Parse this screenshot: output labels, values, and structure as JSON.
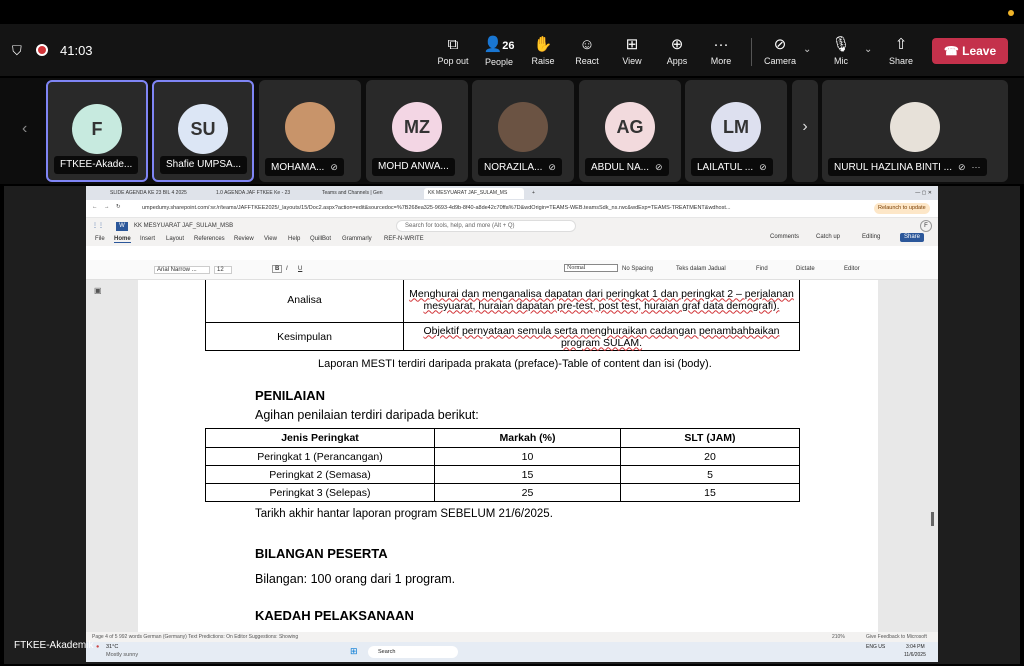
{
  "meeting": {
    "timer": "41:03",
    "participants_count": "26",
    "controls": [
      {
        "label": "Pop out",
        "icon": "pop-out-icon"
      },
      {
        "label": "People",
        "icon": "people-icon"
      },
      {
        "label": "Raise",
        "icon": "hand-icon"
      },
      {
        "label": "React",
        "icon": "smile-icon"
      },
      {
        "label": "View",
        "icon": "grid-icon"
      },
      {
        "label": "Apps",
        "icon": "plus-icon"
      },
      {
        "label": "More",
        "icon": "more-icon"
      },
      {
        "label": "Camera",
        "icon": "camera-off-icon"
      },
      {
        "label": "Mic",
        "icon": "mic-off-icon"
      },
      {
        "label": "Share",
        "icon": "share-icon"
      }
    ],
    "leave_label": "Leave",
    "presenter_name": "FTKEE-Akademik",
    "tiles": [
      {
        "initials": "F",
        "name": "FTKEE-Akade...",
        "color": "#c7eadf"
      },
      {
        "initials": "SU",
        "name": "Shafie UMPSA...",
        "color": "#dce6f5"
      },
      {
        "initials": "",
        "name": "MOHAMA...",
        "color": "#c8946a"
      },
      {
        "initials": "MZ",
        "name": "MOHD ANWA...",
        "color": "#f3d6e4"
      },
      {
        "initials": "",
        "name": "NORAZILA...",
        "color": "#6b5343"
      },
      {
        "initials": "AG",
        "name": "ABDUL NA...",
        "color": "#f2dadd"
      },
      {
        "initials": "LM",
        "name": "LAILATUL ...",
        "color": "#dde0ef"
      },
      {
        "initials": "",
        "name": "NURUL HAZLINA BINTI ...",
        "color": "#e7e1d9"
      }
    ]
  },
  "browser": {
    "tabs": [
      "SLIDE AGENDA KE 23 BIL 4 2025",
      "1.0 AGENDA JAF FTKEE Ke - 23",
      "Teams and Channels | Gen",
      "KK MESYUARAT JAF_SULAM_MS"
    ],
    "url": "umpedumy.sharepoint.com/:w:/r/teams/JAFFTKEE2025/_layouts/15/Doc2.aspx?action=edit&sourcedoc=%7B268ea325-9693-4d9b-8f40-a8de42c70ffa%7D&wdOrigin=TEAMS-WEB.teamsSdk_ns.rwc&wdExp=TEAMS-TREATMENT&wdhost...",
    "update_label": "Relaunch to update"
  },
  "word": {
    "doc_title": "KK MESYUARAT JAF_SULAM_MSB",
    "search_placeholder": "Search for tools, help, and more (Alt + Q)",
    "menu": [
      "File",
      "Home",
      "Insert",
      "Layout",
      "References",
      "Review",
      "View",
      "Help",
      "QuillBot",
      "Grammarly",
      "REF-N-WRITE"
    ],
    "comments": "Comments",
    "catchup": "Catch up",
    "editing": "Editing",
    "share": "Share",
    "font": "Arial Narrow ...",
    "size": "12",
    "style1": "Normal",
    "style2": "No Spacing",
    "style3": "Teks dalam Jadual",
    "find": "Find",
    "dictate": "Dictate",
    "editor": "Editor",
    "status": "Page 4 of 5   992 words   German (Germany)   Text Predictions: On   Editor Suggestions: Showing",
    "zoom": "210%",
    "feedback": "Give Feedback to Microsoft"
  },
  "document": {
    "table1": [
      {
        "label": "Analisa",
        "text": "Menghurai dan menganalisa dapatan dari peringkat 1 dan peringkat 2 – perjalanan mesyuarat, huraian dapatan pre-test, post test, huraian graf data demografi)."
      },
      {
        "label": "Kesimpulan",
        "text": "Objektif pernyataan semula serta menghuraikan cadangan penambahbaikan program SULAM."
      }
    ],
    "laporan_note": "Laporan MESTI terdiri daripada prakata (preface)-Table of content dan isi (body).",
    "penilaian_heading": "PENILAIAN",
    "penilaian_intro": "Agihan penilaian terdiri daripada berikut:",
    "table2_headers": [
      "Jenis Peringkat",
      "Markah (%)",
      "SLT (JAM)"
    ],
    "table2_rows": [
      [
        "Peringkat 1 (Perancangan)",
        "10",
        "20"
      ],
      [
        "Peringkat 2 (Semasa)",
        "15",
        "5"
      ],
      [
        "Peringkat 3 (Selepas)",
        "25",
        "15"
      ]
    ],
    "deadline": "Tarikh akhir hantar laporan program SEBELUM 21/6/2025.",
    "bilangan_heading": "BILANGAN PESERTA",
    "bilangan_text": "Bilangan: 100 orang dari  1 program.",
    "kaedah_heading": "KAEDAH PELAKSANAAN"
  },
  "taskbar": {
    "weather": "31°C",
    "weather_desc": "Mostly sunny",
    "search": "Search",
    "lang": "ENG US",
    "time": "3:04 PM",
    "date": "11/6/2025"
  }
}
